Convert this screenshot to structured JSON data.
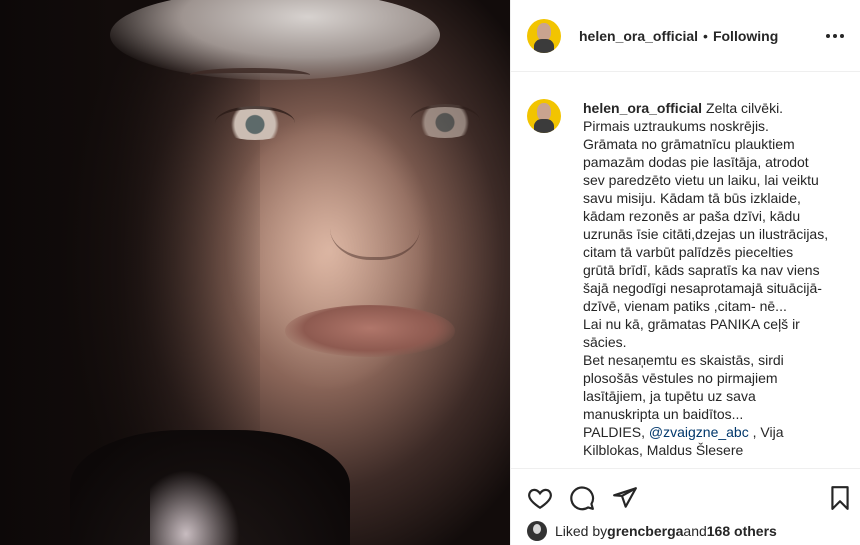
{
  "post": {
    "username": "helen_ora_official",
    "separator": "•",
    "follow_status": "Following",
    "caption_lines": [
      "Zelta cilvēki.",
      "Pirmais uztraukums noskrējis.",
      "Grāmata no grāmatnīcu plauktiem",
      "pamazām dodas pie lasītāja, atrodot",
      "sev paredzēto vietu un laiku, lai veiktu",
      "savu misiju. Kādam tā būs izklaide,",
      "kādam rezonēs ar paša dzīvi, kādu",
      "uzrunās īsie citāti,dzejas un ilustrācijas,",
      "citam tā varbūt palīdzēs piecelties",
      "grūtā brīdī, kāds sapratīs ka nav viens",
      "šajā negodīgi nesaprotamajā situācijā-",
      "dzīvē, vienam patiks ,citam- nē...",
      "Lai nu kā, grāmatas PANIKA ceļš ir",
      "sācies.",
      "Bet nesaņemtu es skaistās, sirdi",
      "plosošās vēstules no pirmajiem",
      "lasītājiem, ja tupētu uz sava",
      "manuskripta un baidītos...",
      "PALDIES, ",
      "Kilblokas, Maldus Šlesere"
    ],
    "mention": "@zvaigzne_abc",
    "after_mention": " , Vija"
  },
  "likes": {
    "prefix": "Liked by ",
    "user": "grencberga",
    "middle": " and ",
    "count_text": "168 others"
  },
  "icons": {
    "like": "heart-icon",
    "comment": "comment-icon",
    "share": "share-icon",
    "save": "bookmark-icon",
    "more": "more-icon"
  },
  "colors": {
    "text": "#262626",
    "border": "#efefef",
    "mention": "#00376b",
    "avatar_bg": "#f2c400"
  }
}
